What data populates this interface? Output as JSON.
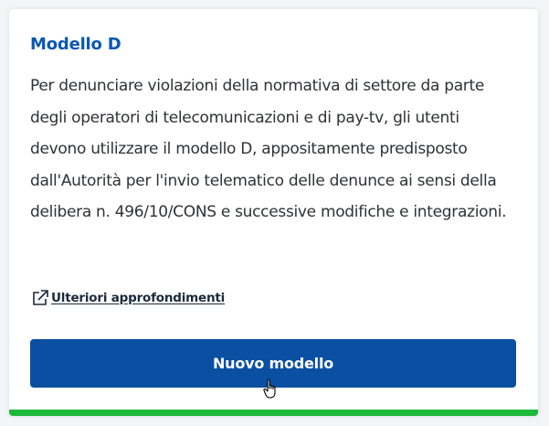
{
  "card": {
    "title": "Modello D",
    "description": "Per denunciare violazioni della normativa di settore da parte degli operatori di telecomunicazioni e di pay-tv, gli utenti devono utilizzare il modello D, appositamente predisposto dall'Autorità per l'invio telematico delle denunce ai sensi della delibera n. 496/10/CONS e successive modifiche e integrazioni.",
    "link": {
      "label": "Ulteriori approfondimenti",
      "icon": "external-link-icon"
    },
    "button": {
      "label": "Nuovo modello"
    }
  },
  "colors": {
    "title": "#0b57b4",
    "button": "#0a4fa2",
    "accent_bar": "#1db93a"
  },
  "cursor": {
    "icon": "hand-pointer-icon"
  }
}
